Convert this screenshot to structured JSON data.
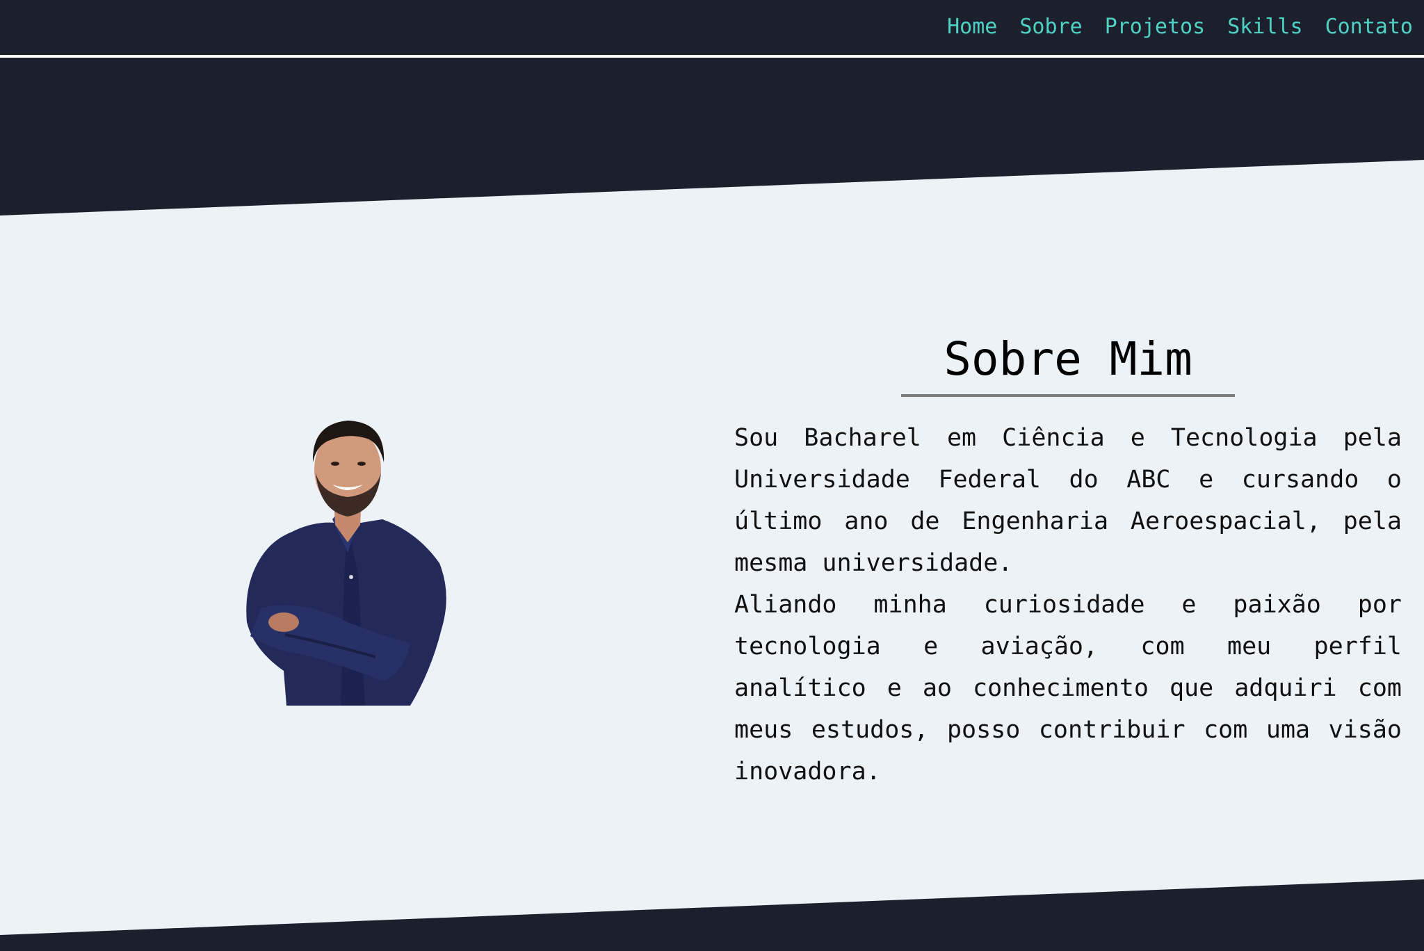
{
  "nav": {
    "items": [
      {
        "label": "Home"
      },
      {
        "label": "Sobre"
      },
      {
        "label": "Projetos"
      },
      {
        "label": "Skills"
      },
      {
        "label": "Contato"
      }
    ]
  },
  "about": {
    "title": "Sobre Mim",
    "paragraphs": [
      "Sou Bacharel em Ciência e Tecnologia pela Universidade Federal do ABC e cursando o último ano de Engenharia Aeroespacial, pela mesma universidade.",
      "Aliando minha curiosidade e paixão por tecnologia e aviação, com meu perfil analítico e ao conhecimento que adquiri com meus estudos, posso contribuir com uma visão inovadora."
    ]
  },
  "colors": {
    "dark_bg": "#1b202c",
    "light_bg": "#edf2f7",
    "accent": "#4fd1c5",
    "rule": "#7a7a7a"
  }
}
